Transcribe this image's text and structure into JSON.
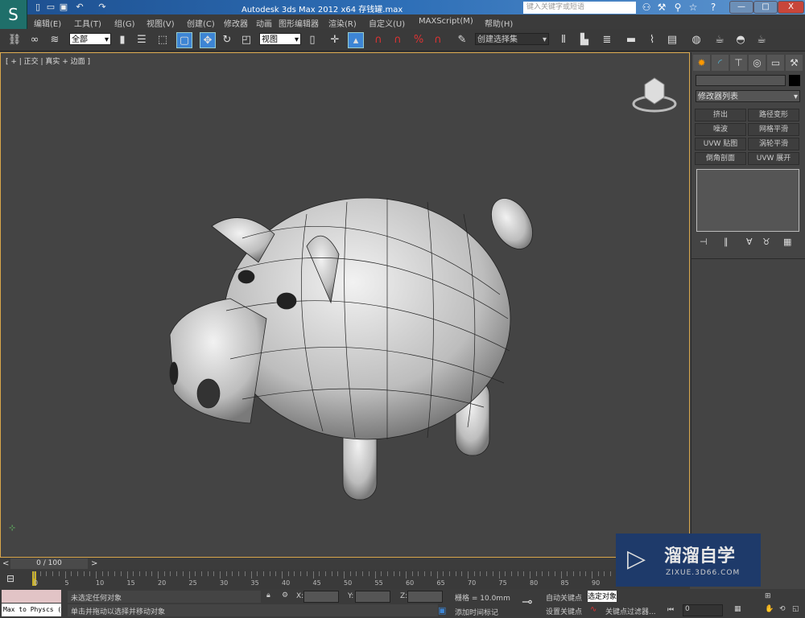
{
  "titlebar": {
    "title": "Autodesk 3ds Max  2012 x64       存钱罐.max",
    "search_placeholder": "键入关键字或短语",
    "min": "—",
    "max": "□",
    "close": "X"
  },
  "menu": [
    "编辑(E)",
    "工具(T)",
    "组(G)",
    "视图(V)",
    "创建(C)",
    "修改器",
    "动画",
    "图形编辑器",
    "渲染(R)",
    "自定义(U)",
    "MAXScript(M)",
    "帮助(H)"
  ],
  "toolbar": {
    "filter": "全部",
    "ref_coord": "视图",
    "selection_set": "创建选择集"
  },
  "viewport": {
    "label": "[ + | 正交 | 真实 + 边面 ]"
  },
  "command_panel": {
    "modifier_list": "修改器列表",
    "buttons": [
      "挤出",
      "路径变形",
      "噪波",
      "网格平滑",
      "UVW 贴图",
      "涡轮平滑",
      "倒角剖面",
      "UVW 展开"
    ]
  },
  "timeline": {
    "frame": "0 / 100",
    "prev": "<",
    "next": ">",
    "ticks": [
      "0",
      "5",
      "10",
      "15",
      "20",
      "25",
      "30",
      "35",
      "40",
      "45",
      "50",
      "55",
      "60",
      "65",
      "70",
      "75",
      "80",
      "85",
      "90"
    ]
  },
  "status": {
    "script_listener": "Max to Physcs (",
    "selection": "未选定任何对象",
    "prompt": "单击并拖动以选择并移动对象",
    "x_label": "X:",
    "y_label": "Y:",
    "z_label": "Z:",
    "grid": "栅格 = 10.0mm",
    "add_time_tag": "添加时间标记",
    "auto_key": "自动关键点",
    "set_key": "设置关键点",
    "selected": "选定对象",
    "key_filters": "关键点过滤器...",
    "current_frame": "0"
  },
  "watermark": {
    "brand": "溜溜自学",
    "url": "ZIXUE.3D66.COM"
  },
  "colors": {
    "accent": "#3d85d4",
    "viewport_border": "#d9a64a",
    "title_bar": "#2e6fb7"
  }
}
